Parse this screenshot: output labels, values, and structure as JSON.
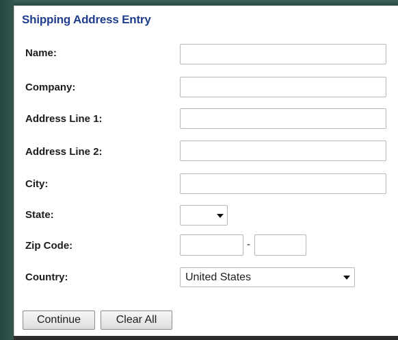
{
  "form": {
    "title": "Shipping Address Entry",
    "fields": [
      {
        "label": "Name:",
        "value": ""
      },
      {
        "label": "Company:",
        "value": ""
      },
      {
        "label": "Address Line 1:",
        "value": ""
      },
      {
        "label": "Address Line 2:",
        "value": ""
      },
      {
        "label": "City:",
        "value": ""
      }
    ],
    "state": {
      "label": "State:",
      "selected": ""
    },
    "zip": {
      "label": "Zip Code:",
      "separator": "-",
      "part1": "",
      "part2": ""
    },
    "country": {
      "label": "Country:",
      "selected": "United States"
    },
    "buttons": {
      "continue_label": "Continue",
      "clear_label": "Clear All"
    }
  },
  "icons": {
    "dropdown": "chevron-down-icon"
  },
  "colors": {
    "title": "#1f3d8c",
    "background_frame": "#2e4f4a",
    "panel": "#ffffff",
    "field_border": "#b7b7b7"
  }
}
